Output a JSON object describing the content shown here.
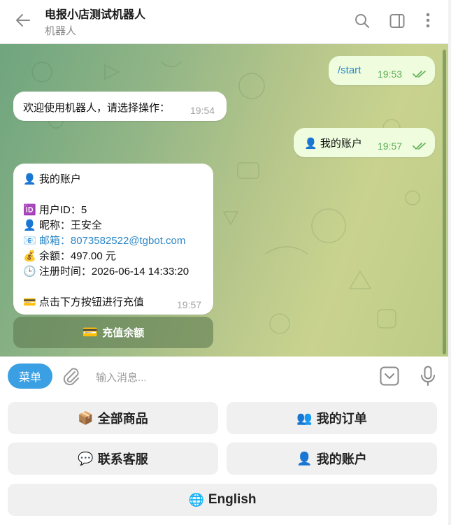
{
  "header": {
    "title": "电报小店测试机器人",
    "subtitle": "机器人"
  },
  "messages": {
    "start": {
      "text": "/start",
      "time": "19:53"
    },
    "welcome": {
      "text": "欢迎使用机器人，请选择操作：",
      "time": "19:54"
    },
    "account_cmd": {
      "emoji": "👤",
      "text": "我的账户",
      "time": "19:57"
    },
    "account_info": {
      "title_emoji": "👤",
      "title": "我的账户",
      "id_emoji": "🆔",
      "id_line": "用户ID：5",
      "nick_emoji": "👤",
      "nick_line": "昵称：王安全",
      "email_emoji": "📧",
      "email_line": "邮箱：8073582522@tgbot.com",
      "balance_emoji": "💰",
      "balance_line": "余额：497.00 元",
      "reg_emoji": "🕒",
      "reg_line": "注册时间：2026-06-14 14:33:20",
      "hint_emoji": "💳",
      "hint_line": "点击下方按钮进行充值",
      "time": "19:57"
    }
  },
  "inline_button": {
    "emoji": "💳",
    "label": "充值余额"
  },
  "input": {
    "menu_label": "菜单",
    "placeholder": "输入消息..."
  },
  "keyboard": {
    "all_products": {
      "emoji": "📦",
      "label": "全部商品"
    },
    "my_orders": {
      "emoji": "👥",
      "label": "我的订单"
    },
    "support": {
      "emoji": "💬",
      "label": "联系客服"
    },
    "my_account": {
      "emoji": "👤",
      "label": "我的账户"
    },
    "english": {
      "emoji": "🌐",
      "label": "English"
    }
  },
  "colors": {
    "accent": "#3a9fe3",
    "outgoing_bubble": "#effdde",
    "read_check": "#5fae55",
    "link": "#2b87c7"
  }
}
